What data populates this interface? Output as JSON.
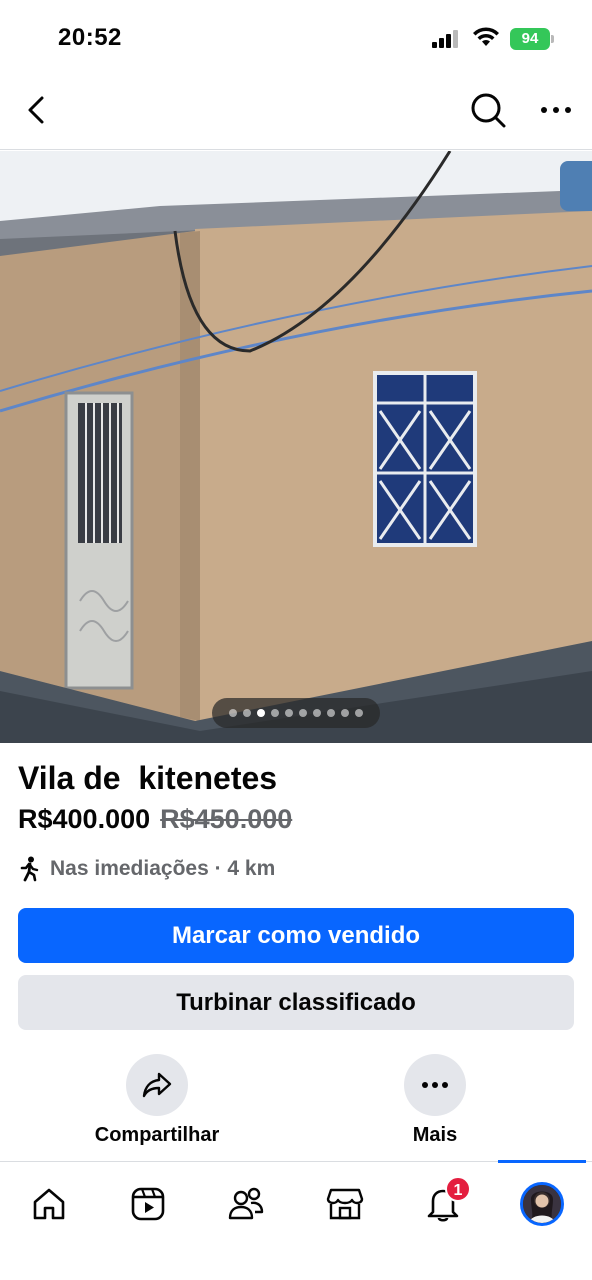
{
  "status_bar": {
    "time": "20:52",
    "battery": "94",
    "icons": [
      "signal-icon",
      "wifi-icon",
      "battery-icon"
    ]
  },
  "header": {
    "back_icon": "chevron-left-icon",
    "search_icon": "search-icon",
    "more_icon": "more-horizontal-icon"
  },
  "photo": {
    "dots_count": 10,
    "active_index": 2
  },
  "listing": {
    "title": "Vila de  kitenetes",
    "price": "R$400.000",
    "old_price": "R$450.000",
    "location": "Nas imediações · 4 km"
  },
  "buttons": {
    "mark_sold": "Marcar como vendido",
    "boost": "Turbinar classificado"
  },
  "actions": {
    "share": "Compartilhar",
    "more": "Mais"
  },
  "bottom_nav": {
    "items": [
      "home-icon",
      "video-icon",
      "friends-icon",
      "marketplace-icon",
      "notifications-icon",
      "profile-avatar"
    ],
    "notification_badge": "1",
    "active": "profile-avatar"
  },
  "colors": {
    "primary": "#0866ff",
    "secondary_bg": "#e4e6eb",
    "badge": "#e41e3f",
    "battery": "#34c759",
    "muted_text": "#65676b"
  }
}
